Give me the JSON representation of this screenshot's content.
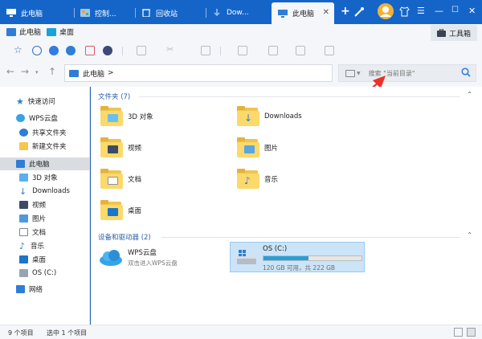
{
  "tabs": [
    {
      "label": "此电脑",
      "icon": "computer-icon",
      "active": false
    },
    {
      "label": "控制...",
      "icon": "control-panel-icon",
      "active": false
    },
    {
      "label": "回收站",
      "icon": "recycle-bin-icon",
      "active": false
    },
    {
      "label": "Dow...",
      "icon": "download-icon",
      "active": false
    },
    {
      "label": "此电脑",
      "icon": "computer-icon",
      "active": true
    }
  ],
  "ribbon": {
    "items": [
      {
        "label": "此电脑"
      },
      {
        "label": "桌面"
      }
    ],
    "toolbox_label": "工具箱"
  },
  "address": {
    "path": "此电脑",
    "separator": ">",
    "search_placeholder": "搜索 \"当前目录\""
  },
  "sidebar": {
    "items": [
      {
        "label": "快速访问"
      },
      {
        "label": "WPS云盘"
      },
      {
        "label": "共享文件夹"
      },
      {
        "label": "新建文件夹"
      },
      {
        "label": "此电脑"
      },
      {
        "label": "3D 对象"
      },
      {
        "label": "Downloads"
      },
      {
        "label": "视频"
      },
      {
        "label": "图片"
      },
      {
        "label": "文档"
      },
      {
        "label": "音乐"
      },
      {
        "label": "桌面"
      },
      {
        "label": "OS (C:)"
      },
      {
        "label": "网络"
      }
    ]
  },
  "main": {
    "folders_group": "文件夹 (7)",
    "folders": [
      {
        "label": "3D 对象"
      },
      {
        "label": "Downloads"
      },
      {
        "label": "视频"
      },
      {
        "label": "图片"
      },
      {
        "label": "文档"
      },
      {
        "label": "音乐"
      },
      {
        "label": "桌面"
      }
    ],
    "devices_group": "设备和驱动器 (2)",
    "wps": {
      "name": "WPS云盘",
      "desc": "双击进入WPS云盘"
    },
    "drive": {
      "name": "OS (C:)",
      "free_text": "120 GB 可用，共 222 GB",
      "used_fraction": 0.46
    }
  },
  "status": {
    "count": "9 个项目",
    "selected": "选中 1 个项目"
  },
  "colors": {
    "tabbar": "#1565c9",
    "folder": "#fbd96a",
    "accent": "#2a5ea8",
    "arrow": "#e8322a"
  }
}
